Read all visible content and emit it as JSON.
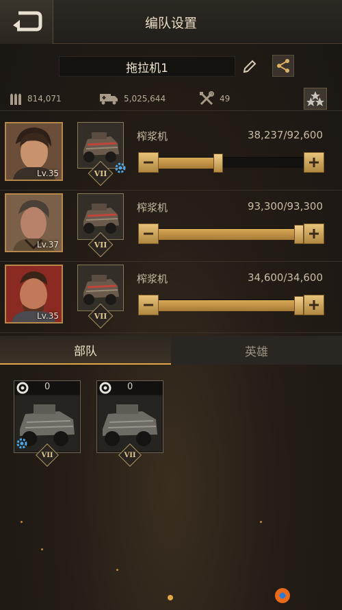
{
  "header": {
    "title": "编队设置"
  },
  "formation": {
    "name": "拖拉机1"
  },
  "resources": {
    "ammo": "814,071",
    "supply": "5,025,644",
    "repair": "49"
  },
  "heroes": [
    {
      "level": "Lv.35",
      "vehicle_name": "榨浆机",
      "count": "38,237/92,600",
      "fill": 0.41,
      "has_gear": true
    },
    {
      "level": "Lv.37",
      "vehicle_name": "榨浆机",
      "count": "93,300/93,300",
      "fill": 1.0,
      "has_gear": false
    },
    {
      "level": "Lv.35",
      "vehicle_name": "榨浆机",
      "count": "34,600/34,600",
      "fill": 1.0,
      "has_gear": false
    }
  ],
  "rank_label": "VII",
  "tabs": [
    {
      "label": "部队",
      "active": true
    },
    {
      "label": "英雄",
      "active": false
    }
  ],
  "units": [
    {
      "count": "0",
      "rank": "VII",
      "has_gear": true
    },
    {
      "count": "0",
      "rank": "VII",
      "has_gear": false
    }
  ],
  "colors": {
    "accent": "#e0a848",
    "gold": "#c9a05a",
    "background": "#221d18",
    "frame": "#b8884a"
  },
  "icons": {
    "back": "back-arrow-icon",
    "edit": "pencil-icon",
    "share": "share-icon",
    "ammo": "ammo-icon",
    "supply": "truck-icon",
    "repair": "wrench-icon",
    "stars": "stars-icon",
    "tire": "tire-icon",
    "gear": "gear-icon"
  }
}
